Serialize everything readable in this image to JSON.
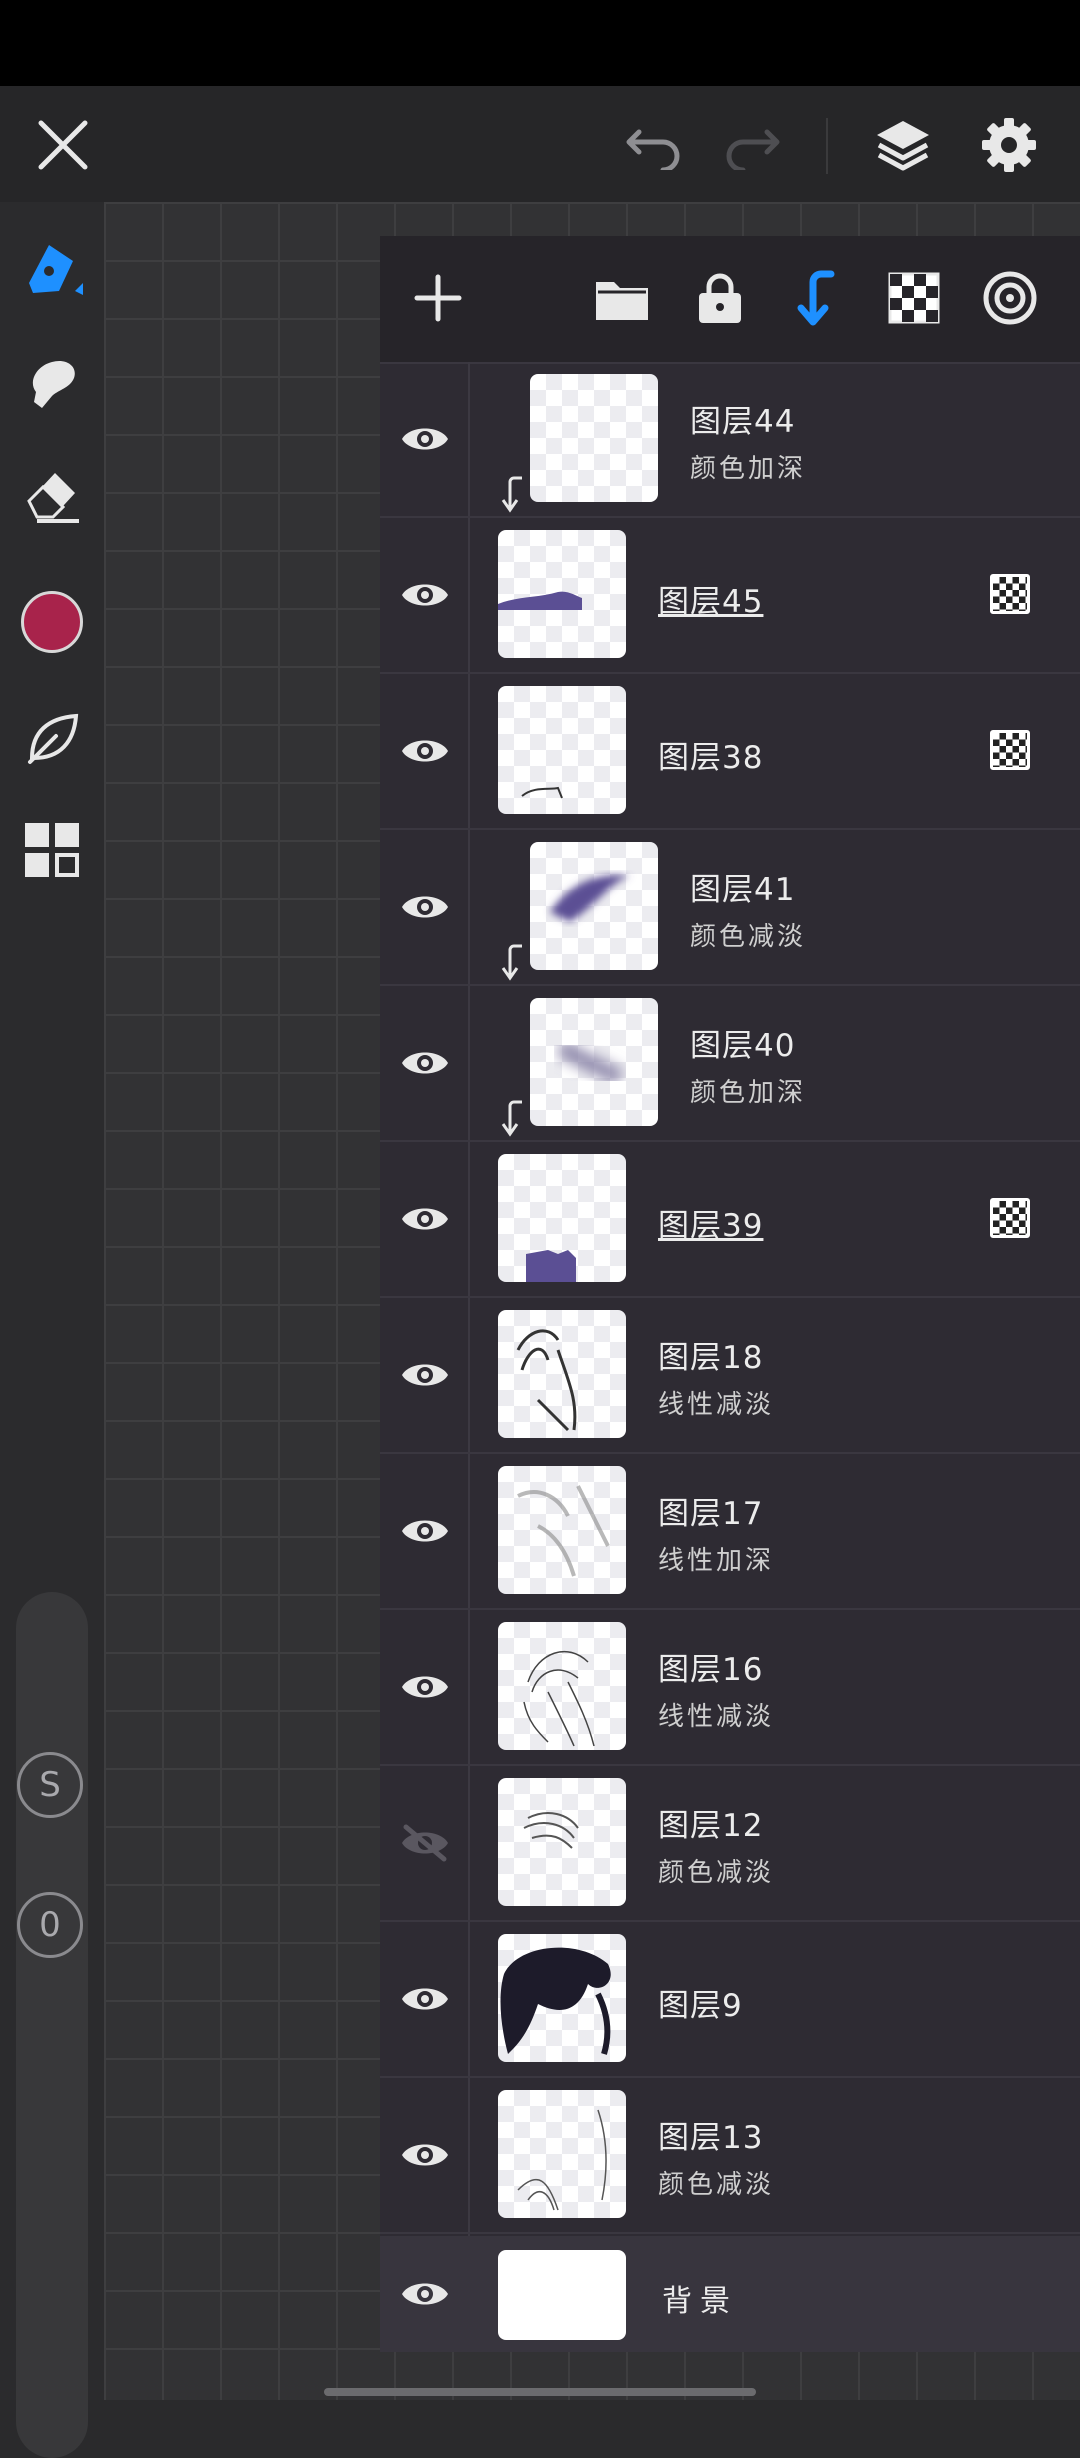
{
  "colors": {
    "accent": "#1e90ff",
    "brush_color": "#a8234b",
    "panel_bg": "#2e2b33"
  },
  "top_bar": {
    "icons": [
      "close-icon",
      "undo-icon",
      "redo-icon",
      "layers-icon",
      "settings-icon"
    ]
  },
  "left_toolbar": {
    "tools": [
      "pencil-icon",
      "smudge-icon",
      "eraser-icon",
      "color-swatch",
      "leaf-icon",
      "grid-icon"
    ],
    "badge_s": "S",
    "badge_0": "0"
  },
  "layers_toolbar": {
    "add": "+",
    "icons": [
      "add-layer-icon",
      "folder-icon",
      "lock-icon",
      "clip-down-icon",
      "checker-icon",
      "target-icon"
    ]
  },
  "layers": [
    {
      "name": "图层44",
      "mode": "颜色加深",
      "visible": true,
      "clipped": true,
      "thumb": "clip",
      "alpha_lock": false,
      "underline": false
    },
    {
      "name": "图层45",
      "mode": "",
      "visible": true,
      "clipped": false,
      "thumb": "shape45",
      "alpha_lock": true,
      "underline": true
    },
    {
      "name": "图层38",
      "mode": "",
      "visible": true,
      "clipped": false,
      "thumb": "lines38",
      "alpha_lock": true,
      "underline": false
    },
    {
      "name": "图层41",
      "mode": "颜色减淡",
      "visible": true,
      "clipped": true,
      "thumb": "blur41",
      "alpha_lock": false,
      "underline": false
    },
    {
      "name": "图层40",
      "mode": "颜色加深",
      "visible": true,
      "clipped": true,
      "thumb": "blur40",
      "alpha_lock": false,
      "underline": false
    },
    {
      "name": "图层39",
      "mode": "",
      "visible": true,
      "clipped": false,
      "thumb": "shape39",
      "alpha_lock": true,
      "underline": true
    },
    {
      "name": "图层18",
      "mode": "线性减淡",
      "visible": true,
      "clipped": false,
      "thumb": "hair18",
      "alpha_lock": false,
      "underline": false
    },
    {
      "name": "图层17",
      "mode": "线性加深",
      "visible": true,
      "clipped": false,
      "thumb": "hair17",
      "alpha_lock": false,
      "underline": false
    },
    {
      "name": "图层16",
      "mode": "线性减淡",
      "visible": true,
      "clipped": false,
      "thumb": "hair16",
      "alpha_lock": false,
      "underline": false
    },
    {
      "name": "图层12",
      "mode": "颜色减淡",
      "visible": false,
      "clipped": false,
      "thumb": "hair12",
      "alpha_lock": false,
      "underline": false
    },
    {
      "name": "图层9",
      "mode": "",
      "visible": true,
      "clipped": false,
      "thumb": "hair9",
      "alpha_lock": false,
      "underline": false
    },
    {
      "name": "图层13",
      "mode": "颜色减淡",
      "visible": true,
      "clipped": false,
      "thumb": "hair13",
      "alpha_lock": false,
      "underline": false
    }
  ],
  "background_layer": {
    "name": "背景",
    "visible": true
  }
}
